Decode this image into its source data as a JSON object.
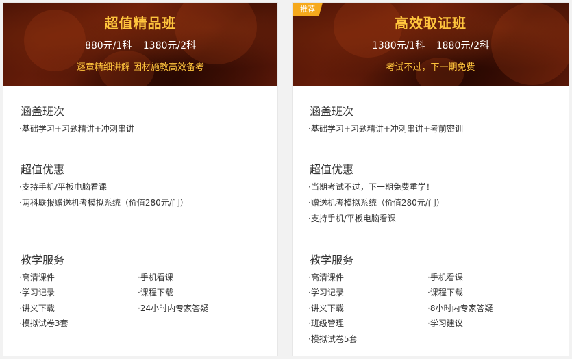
{
  "cards": [
    {
      "title": "超值精品班",
      "price1": "880元/1科",
      "price2": "1380元/2科",
      "slogan": "逐章精细讲解 因材施教高效备考",
      "coverage_title": "涵盖班次",
      "coverage_text": "·基础学习+习题精讲+冲刺串讲",
      "benefits_title": "超值优惠",
      "benefits": [
        "·支持手机/平板电脑看课",
        "·两科联报赠送机考模拟系统（价值280元/门）"
      ],
      "services_title": "教学服务",
      "services": [
        "·高清课件",
        "·手机看课",
        "·学习记录",
        "·课程下载",
        "·讲义下载",
        "·24小时内专家答疑",
        "·模拟试卷3套"
      ]
    },
    {
      "badge": "推荐",
      "title": "高效取证班",
      "price1": "1380元/1科",
      "price2": "1880元/2科",
      "slogan": "考试不过，下一期免费",
      "coverage_title": "涵盖班次",
      "coverage_text": "·基础学习+习题精讲+冲刺串讲+考前密训",
      "benefits_title": "超值优惠",
      "benefits": [
        "·当期考试不过，下一期免费重学！",
        "·赠送机考模拟系统（价值280元/门）",
        "·支持手机/平板电脑看课"
      ],
      "services_title": "教学服务",
      "services": [
        "·高清课件",
        "·手机看课",
        "·学习记录",
        "·课程下载",
        "·讲义下载",
        "·8小时内专家答疑",
        "·班级管理",
        "·学习建议",
        "·模拟试卷5套"
      ]
    }
  ],
  "colors": {
    "accent_gold": "#ffc53d",
    "badge_orange": "#f6a91c",
    "banner_dark": "#4a1306"
  }
}
